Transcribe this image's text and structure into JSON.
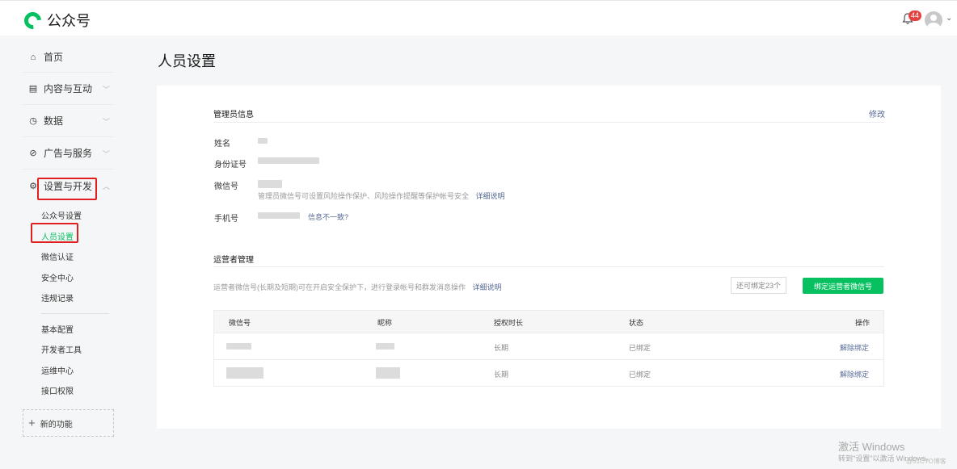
{
  "app": {
    "name": "公众号"
  },
  "topbar": {
    "badge_count": "44"
  },
  "sidebar": {
    "home": "首页",
    "content": "内容与互动",
    "data": "数据",
    "ads": "广告与服务",
    "settings": "设置与开发",
    "sub_items_1": [
      "公众号设置",
      "人员设置",
      "微信认证",
      "安全中心",
      "违规记录"
    ],
    "sub_items_2": [
      "基本配置",
      "开发者工具",
      "运维中心",
      "接口权限"
    ],
    "new_func": "新的功能",
    "active_item": "人员设置"
  },
  "page": {
    "title": "人员设置"
  },
  "admin": {
    "section_title": "管理员信息",
    "edit": "修改",
    "name_label": "姓名",
    "id_label": "身份证号",
    "wechat_label": "微信号",
    "wechat_hint": "管理员微信号可设置风险操作保护、风险操作提醒等保护帐号安全",
    "wechat_hint_link": "详细说明",
    "phone_label": "手机号",
    "phone_link": "信息不一致?"
  },
  "operators": {
    "section_title": "运营者管理",
    "desc": "运营者微信号(长期及短期)可在开启安全保护下，进行登录帐号和群发消息操作",
    "desc_link": "详细说明",
    "remaining": "还可绑定23个",
    "bind_button": "绑定运营者微信号",
    "columns": [
      "微信号",
      "昵称",
      "授权时长",
      "状态",
      "操作"
    ],
    "rows": [
      {
        "duration": "长期",
        "status": "已绑定",
        "action": "解除绑定"
      },
      {
        "duration": "长期",
        "status": "已绑定",
        "action": "解除绑定"
      }
    ]
  },
  "watermark": {
    "line1": "激活 Windows",
    "line2": "转到\"设置\"以激活 Windows。",
    "line3": "@51CTO博客"
  },
  "colors": {
    "accent": "#07c160",
    "link": "#576b95",
    "highlight": "#e02020"
  }
}
